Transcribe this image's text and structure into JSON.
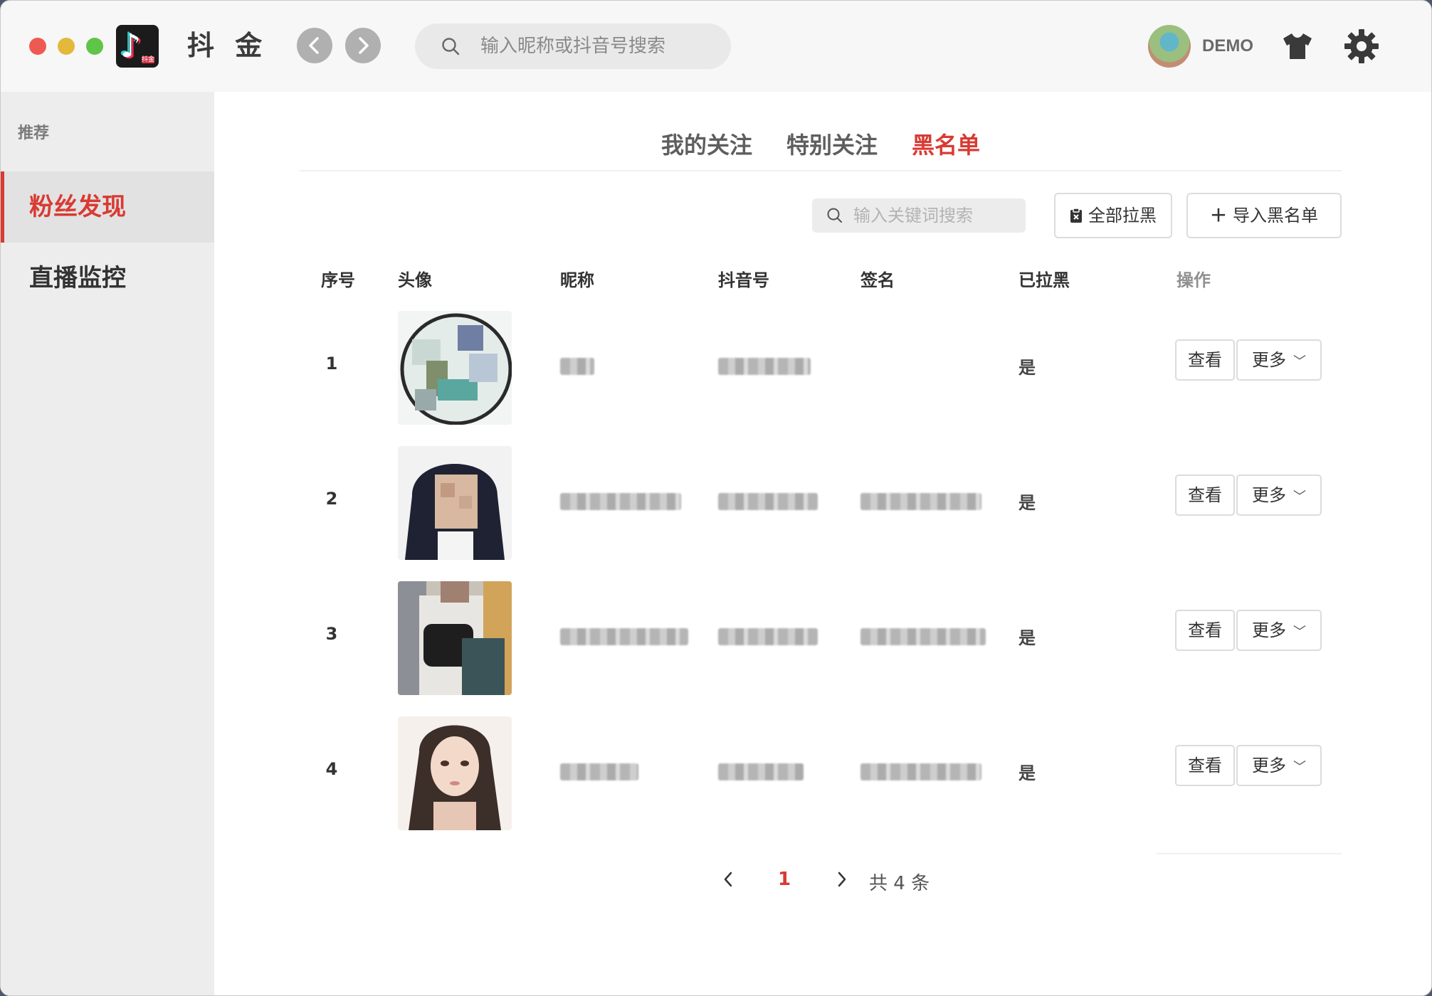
{
  "app": {
    "title": "抖 金",
    "logo_mini": "抖金"
  },
  "header": {
    "search_placeholder": "输入昵称或抖音号搜索",
    "user_name": "DEMO",
    "icons": {
      "back": "chevron-left-icon",
      "forward": "chevron-right-icon",
      "skin": "tshirt-icon",
      "settings": "gear-icon"
    }
  },
  "sidebar": {
    "section": "推荐",
    "items": [
      {
        "label": "粉丝发现",
        "active": true
      },
      {
        "label": "直播监控",
        "active": false
      }
    ]
  },
  "tabs": [
    {
      "label": "我的关注",
      "active": false
    },
    {
      "label": "特别关注",
      "active": false
    },
    {
      "label": "黑名单",
      "active": true
    }
  ],
  "toolbar": {
    "search_placeholder": "输入关键词搜索",
    "block_all_label": "全部拉黑",
    "import_label": "导入黑名单"
  },
  "table": {
    "headers": [
      "序号",
      "头像",
      "昵称",
      "抖音号",
      "签名",
      "已拉黑",
      "操作"
    ],
    "rows": [
      {
        "index": "1",
        "blocked": "是",
        "view": "查看",
        "more": "更多"
      },
      {
        "index": "2",
        "blocked": "是",
        "view": "查看",
        "more": "更多"
      },
      {
        "index": "3",
        "blocked": "是",
        "view": "查看",
        "more": "更多"
      },
      {
        "index": "4",
        "blocked": "是",
        "view": "查看",
        "more": "更多"
      }
    ]
  },
  "pagination": {
    "current": "1",
    "total_text": "共 4 条"
  },
  "colors": {
    "accent": "#d93a33",
    "sidebar_bg": "#ededed",
    "titlebar_bg": "#f7f7f7"
  }
}
